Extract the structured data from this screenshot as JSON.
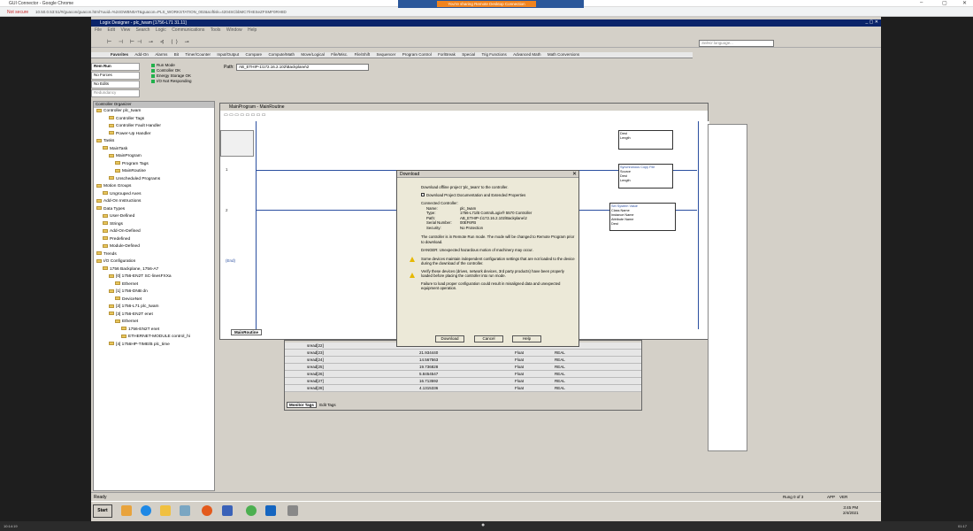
{
  "browser": {
    "title": "GUI Connector - Google Chrome",
    "not_secure": "Not secure",
    "url": "10.50.0.53:51/#/guacon/guacon.html?uuid=%24GWBN0AT&guacon=PLS_WORKSTATION_002&softisk=4204SCbbMC7/HESeZFSMF0RH8D",
    "rdp_banner": "You're sharing Remote Desktop Connection"
  },
  "logix": {
    "title": "Logix Designer - plc_twam [1756-L71 31.11]",
    "menu": [
      "File",
      "Edit",
      "View",
      "Search",
      "Logic",
      "Communications",
      "Tools",
      "Window",
      "Help"
    ],
    "instr_tabs": [
      "Favorites",
      "Add-On",
      "Alarms",
      "Bit",
      "Timer/Counter",
      "Input/Output",
      "Compare",
      "Compute/Math",
      "Move/Logical",
      "File/Misc.",
      "File/Shift",
      "Sequencer",
      "Program Control",
      "For/Break",
      "Special",
      "Trig Functions",
      "Advanced Math",
      "Math Conversions"
    ],
    "lang_placeholder": "Select language...",
    "path_label": "Path:",
    "path_value": "AB_ETHIP-1\\172.16.2.102\\Backplane\\2",
    "status": {
      "mode": "Rem Run",
      "forces": "No Forces",
      "edits": "No Edits",
      "redundancy": "Redundancy",
      "run_mode": "Run Mode",
      "controller_ok": "Controller OK",
      "energy_ok": "Energy Storage OK",
      "io": "I/O Not Responding"
    }
  },
  "organizer": {
    "title": "Controller Organizer",
    "items": [
      "Controller plc_twam",
      "Controller Tags",
      "Controller Fault Handler",
      "Power-Up Handler",
      "Tasks",
      "MainTask",
      "MainProgram",
      "Program Tags",
      "MainRoutine",
      "Unscheduled Programs",
      "Motion Groups",
      "Ungrouped Axes",
      "Add-On Instructions",
      "Data Types",
      "User-Defined",
      "Strings",
      "Add-On-Defined",
      "Predefined",
      "Module-Defined",
      "Trends",
      "I/O Configuration",
      "1756 Backplane, 1756-A7",
      "[0] 1756-EN2T SC-linesFXXa",
      "Ethernet",
      "[1] 1756-DNB dn",
      "DeviceNet",
      "[2] 1756-L71 plc_twam",
      "[3] 1756-EN2T enet",
      "Ethernet",
      "1756-EN2T enet",
      "ETHERNET-MODULE control_hi",
      "[4] 1756HP-TIME/B plc_time"
    ]
  },
  "routine": {
    "title": "MainProgram - MainRoutine",
    "tab": "MainRoutine",
    "rungs": [
      "1",
      "2",
      "(End)"
    ],
    "instr1": [
      "Dest",
      "Length",
      "Synchronous Copy File",
      "Source",
      "Dest",
      "Length"
    ],
    "instr2": [
      "Set System Value",
      "Class Name",
      "Instance Name",
      "Attribute Name",
      "Dest"
    ]
  },
  "tags": {
    "rows": [
      {
        "name": "sread[22]",
        "value": "",
        "type": "Float",
        "style": "REAL"
      },
      {
        "name": "sread[23]",
        "value": "21.934440",
        "type": "Float",
        "style": "REAL"
      },
      {
        "name": "sread[24]",
        "value": "14.567563",
        "type": "Float",
        "style": "REAL"
      },
      {
        "name": "sread[25]",
        "value": "19.736828",
        "type": "Float",
        "style": "REAL"
      },
      {
        "name": "sread[26]",
        "value": "5.8454547",
        "type": "Float",
        "style": "REAL"
      },
      {
        "name": "sread[27]",
        "value": "16.713592",
        "type": "Float",
        "style": "REAL"
      },
      {
        "name": "sread[28]",
        "value": "4.1315336",
        "type": "Float",
        "style": "REAL"
      }
    ],
    "tabs": [
      "Monitor Tags",
      "Edit Tags"
    ]
  },
  "dialog": {
    "title": "Download",
    "intro": "Download offline project 'plc_twam' to the controller.",
    "checkbox": "Download Project Documentation and Extended Properties",
    "connected": "Connected Controller:",
    "fields": [
      {
        "k": "Name:",
        "v": "plc_twam"
      },
      {
        "k": "Type:",
        "v": "1756-L71/B ControlLogix® 5570 Controller"
      },
      {
        "k": "Path:",
        "v": "AB_ETHIP-1\\172.16.2.102\\Backplane\\2"
      },
      {
        "k": "Serial Number:",
        "v": "00EF6FB"
      },
      {
        "k": "Security:",
        "v": "No Protection"
      }
    ],
    "warn1": "The controller is in Remote Run mode. The mode will be changed to Remote Program prior to download.",
    "danger": "DANGER: Unexpected hazardous motion of machinery may occur.",
    "p1": "Some devices maintain independent configuration settings that are not loaded to the device during the download of the controller.",
    "p2": "Verify these devices (drives, network devices, 3rd party products) have been properly loaded before placing the controller into run mode.",
    "p3": "Failure to load proper configuration could result in misaligned data and unexpected equipment operation.",
    "buttons": [
      "Download",
      "Cancel",
      "Help"
    ]
  },
  "statusbar": {
    "ready": "Ready",
    "rung": "Rung 0 of 3",
    "app": "APP",
    "ver": "VER"
  },
  "taskbar": {
    "start": "Start",
    "time": "3:45 PM",
    "date": "2/4/2021"
  },
  "bottom": {
    "left": "10:14:19",
    "right": "01:17"
  }
}
